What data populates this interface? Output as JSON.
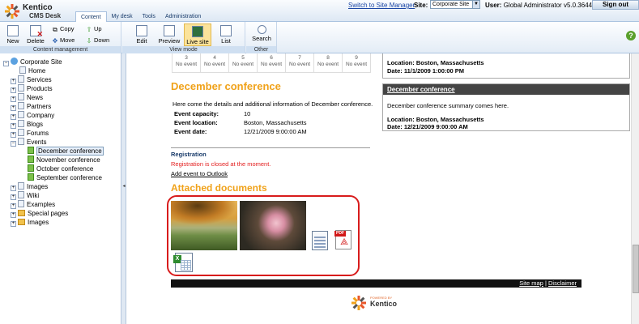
{
  "app": {
    "logo_line1": "Kentico",
    "logo_line2": "CMS Desk"
  },
  "tabs": [
    {
      "label": "Content"
    },
    {
      "label": "My desk"
    },
    {
      "label": "Tools"
    },
    {
      "label": "Administration"
    }
  ],
  "header": {
    "switch_link": "Switch to Site Manager",
    "site_label": "Site:",
    "site_value": "Corporate Site",
    "user_label": "User:",
    "user_name": "Global Administrator",
    "version": "v5.0.3644",
    "signout": "Sign out"
  },
  "ribbon": {
    "content_management": {
      "title": "Content management",
      "new": "New",
      "delete": "Delete",
      "copy": "Copy",
      "move": "Move",
      "up": "Up",
      "down": "Down"
    },
    "view_mode": {
      "title": "View mode",
      "edit": "Edit",
      "preview": "Preview",
      "live_site": "Live site",
      "list": "List"
    },
    "other": {
      "title": "Other",
      "search": "Search"
    }
  },
  "tree": {
    "root": "Corporate Site",
    "items": [
      "Home",
      "Services",
      "Products",
      "News",
      "Partners",
      "Company",
      "Blogs",
      "Forums",
      "Events",
      "December conference",
      "November conference",
      "October conference",
      "September conference",
      "Images",
      "Wiki",
      "Examples",
      "Special pages",
      "Images"
    ]
  },
  "calendar": [
    {
      "day": "3",
      "text": "No event"
    },
    {
      "day": "4",
      "text": "No event"
    },
    {
      "day": "5",
      "text": "No event"
    },
    {
      "day": "6",
      "text": "No event"
    },
    {
      "day": "7",
      "text": "No event"
    },
    {
      "day": "8",
      "text": "No event"
    },
    {
      "day": "9",
      "text": "No event"
    }
  ],
  "event": {
    "title": "December conference",
    "intro": "Here come the details and additional information of December conference.",
    "capacity_label": "Event capacity:",
    "capacity": "10",
    "location_label": "Event location:",
    "location": "Boston, Massachusetts",
    "date_label": "Event date:",
    "date": "12/21/2009 9:00:00 AM",
    "registration_heading": "Registration",
    "registration_status": "Registration is closed at the moment.",
    "add_to_outlook": "Add event to Outlook",
    "attached_heading": "Attached documents"
  },
  "side": {
    "prev_location": "Location: Boston, Massachusetts",
    "prev_date": "Date: 11/1/2009 1:00:00 PM",
    "box_title": "December conference",
    "summary": "December conference summary comes here.",
    "location": "Location: Boston, Massachusetts",
    "date": "Date: 12/21/2009 9:00:00 AM"
  },
  "footer": {
    "site_map": "Site map",
    "separator": "|",
    "disclaimer": "Disclaimer",
    "powered_by": "POWERED BY",
    "brand": "Kentico"
  },
  "colors": {
    "accent_orange": "#f0a21a",
    "alert_red": "#e31c1c",
    "highlight_box": "#d81c1c"
  }
}
